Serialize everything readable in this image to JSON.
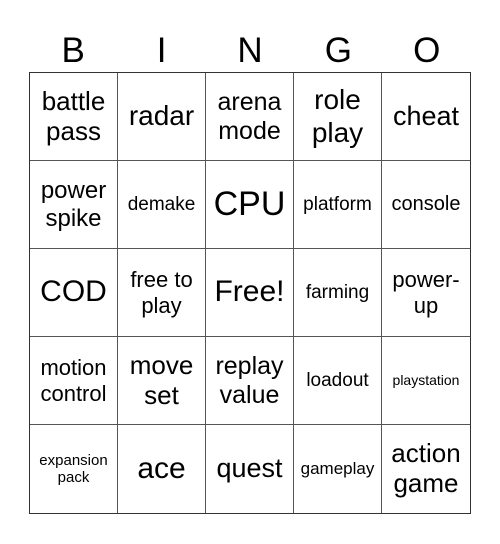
{
  "card": {
    "header": [
      "B",
      "I",
      "N",
      "G",
      "O"
    ],
    "rows": [
      [
        "battle pass",
        "radar",
        "arena mode",
        "role play",
        "cheat"
      ],
      [
        "power spike",
        "demake",
        "CPU",
        "platform",
        "console"
      ],
      [
        "COD",
        "free to play",
        "Free!",
        "farming",
        "power-up"
      ],
      [
        "motion control",
        "move set",
        "replay value",
        "loadout",
        "playstation"
      ],
      [
        "expansion pack",
        "ace",
        "quest",
        "gameplay",
        "action game"
      ]
    ],
    "free_space": "Free!"
  }
}
